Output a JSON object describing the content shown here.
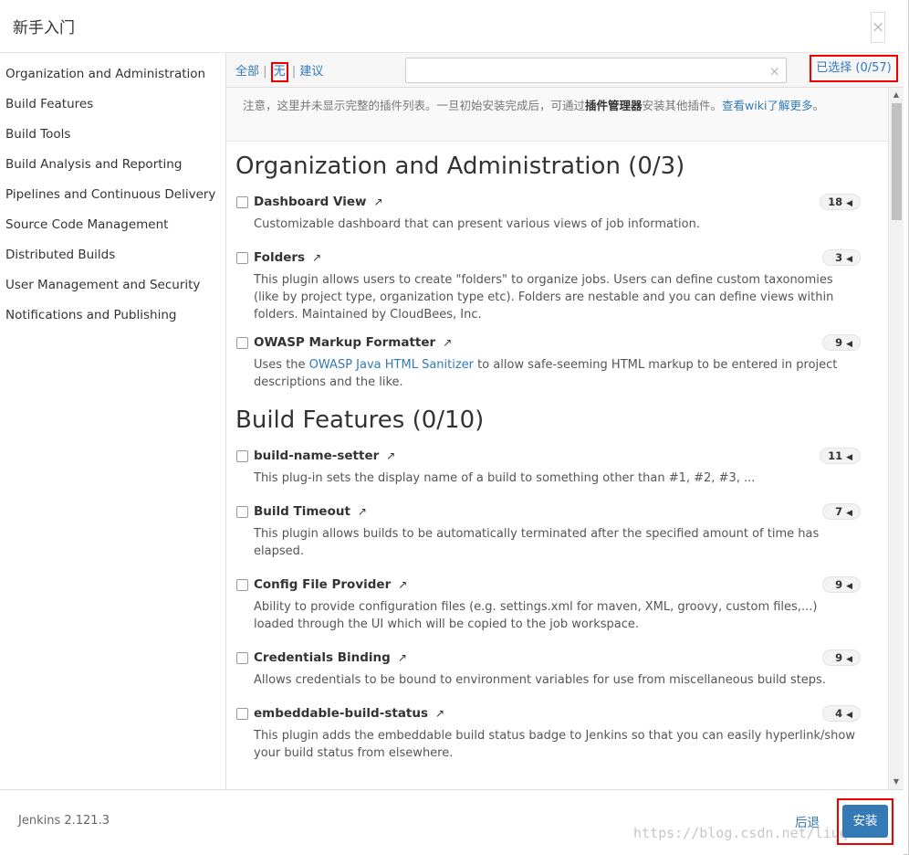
{
  "dialog": {
    "title": "新手入门",
    "close_icon": "×"
  },
  "sidebar": {
    "categories": [
      "Organization and Administration",
      "Build Features",
      "Build Tools",
      "Build Analysis and Reporting",
      "Pipelines and Continuous Delivery",
      "Source Code Management",
      "Distributed Builds",
      "User Management and Security",
      "Notifications and Publishing"
    ]
  },
  "toolbar": {
    "filter_all": "全部",
    "filter_sep": "|",
    "filter_none": "无",
    "filter_suggested": "建议",
    "search_value": "",
    "clear_icon": "×",
    "selected_label": "已选择 (0/57)"
  },
  "notice": {
    "part1": "注意，这里并未显示完整的插件列表。一旦初始安装完成后，可通过",
    "bold": "插件管理器",
    "part2": "安装其他插件。",
    "link": "查看wiki了解更多",
    "end": "。"
  },
  "sections": [
    {
      "title": "Organization and Administration (0/3)",
      "plugins": [
        {
          "name": "Dashboard View",
          "count": "18",
          "desc": "Customizable dashboard that can present various views of job information."
        },
        {
          "name": "Folders",
          "count": "3",
          "desc": "This plugin allows users to create \"folders\" to organize jobs. Users can define custom taxonomies (like by project type, organization type etc). Folders are nestable and you can define views within folders. Maintained by CloudBees, Inc."
        },
        {
          "name": "OWASP Markup Formatter",
          "count": "9",
          "desc_pre": "Uses the ",
          "desc_link": "OWASP Java HTML Sanitizer",
          "desc_post": " to allow safe-seeming HTML markup to be entered in project descriptions and the like."
        }
      ]
    },
    {
      "title": "Build Features (0/10)",
      "plugins": [
        {
          "name": "build-name-setter",
          "count": "11",
          "desc": "This plug-in sets the display name of a build to something other than #1, #2, #3, ..."
        },
        {
          "name": "Build Timeout",
          "count": "7",
          "desc": "This plugin allows builds to be automatically terminated after the specified amount of time has elapsed."
        },
        {
          "name": "Config File Provider",
          "count": "9",
          "desc": "Ability to provide configuration files (e.g. settings.xml for maven, XML, groovy, custom files,...) loaded through the UI which will be copied to the job workspace."
        },
        {
          "name": "Credentials Binding",
          "count": "9",
          "desc": "Allows credentials to be bound to environment variables for use from miscellaneous build steps."
        },
        {
          "name": "embeddable-build-status",
          "count": "4",
          "desc": "This plugin adds the embeddable build status badge to Jenkins so that you can easily hyperlink/show your build status from elsewhere."
        }
      ]
    }
  ],
  "icons": {
    "external_link": "↗",
    "badge_arrow": "◀",
    "scroll_up": "▲",
    "scroll_down": "▼"
  },
  "footer": {
    "version": "Jenkins 2.121.3",
    "back_label": "后退",
    "install_label": "安装",
    "watermark": "https://blog.csdn.net/liuqan"
  },
  "colors": {
    "link": "#337ab7",
    "primary_button": "#337ab7",
    "highlight_border": "#e00000"
  }
}
